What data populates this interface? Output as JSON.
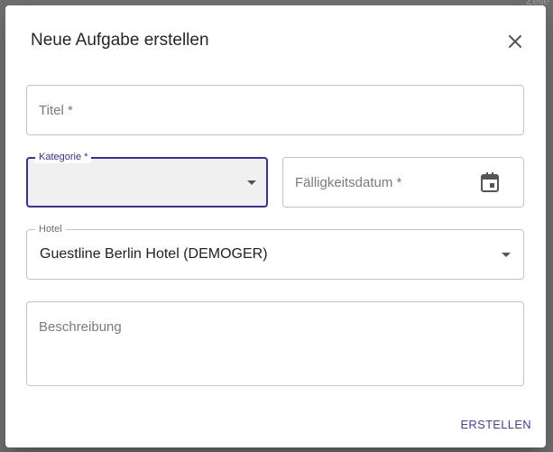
{
  "background": {
    "peek_text": "Zeile"
  },
  "dialog": {
    "title": "Neue Aufgabe erstellen",
    "close_icon": "close-icon"
  },
  "form": {
    "title_field": {
      "placeholder": "Titel *"
    },
    "category_field": {
      "label": "Kategorie *",
      "value": "",
      "state": "focused",
      "accent": "#3f2a9e"
    },
    "due_date_field": {
      "placeholder": "Fälligkeitsdatum *",
      "icon": "calendar-icon"
    },
    "hotel_field": {
      "label": "Hotel",
      "value": "Guestline Berlin Hotel (DEMOGER)"
    },
    "description_field": {
      "placeholder": "Beschreibung"
    }
  },
  "actions": {
    "create_label": "ERSTELLEN",
    "accent": "#4b3ba7"
  }
}
